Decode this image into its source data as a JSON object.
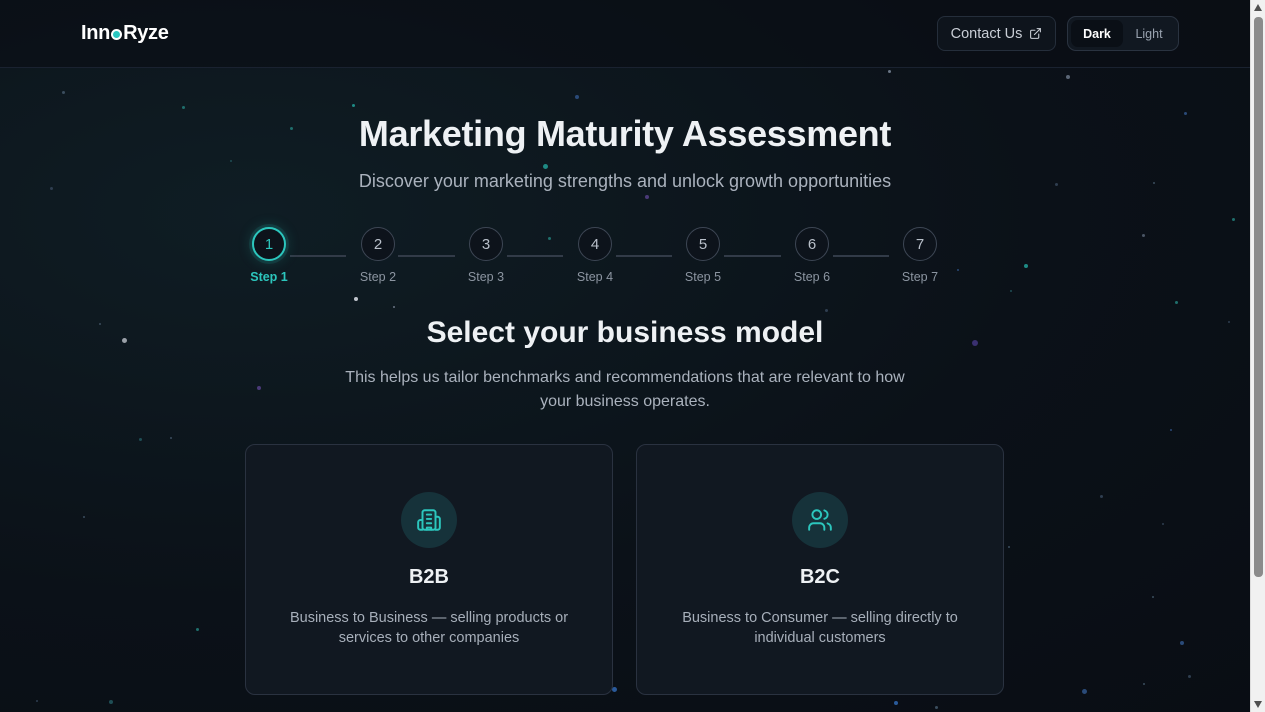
{
  "brand": {
    "name_part1": "Inn",
    "name_part2": "Ryze"
  },
  "header": {
    "contact_label": "Contact Us",
    "theme": {
      "options": [
        "Dark",
        "Light"
      ],
      "selected": "Dark"
    }
  },
  "hero": {
    "title": "Marketing Maturity Assessment",
    "subtitle": "Discover your marketing strengths and unlock growth opportunities"
  },
  "stepper": {
    "current_step": 1,
    "steps": [
      {
        "number": "1",
        "label": "Step 1"
      },
      {
        "number": "2",
        "label": "Step 2"
      },
      {
        "number": "3",
        "label": "Step 3"
      },
      {
        "number": "4",
        "label": "Step 4"
      },
      {
        "number": "5",
        "label": "Step 5"
      },
      {
        "number": "6",
        "label": "Step 6"
      },
      {
        "number": "7",
        "label": "Step 7"
      }
    ]
  },
  "section": {
    "title": "Select your business model",
    "description": "This helps us tailor benchmarks and recommendations that are relevant to how your business operates."
  },
  "options": [
    {
      "icon": "building-icon",
      "name": "B2B",
      "description": "Business to Business — selling products or services to other companies"
    },
    {
      "icon": "users-icon",
      "name": "B2C",
      "description": "Business to Consumer — selling directly to individual customers"
    }
  ],
  "colors": {
    "accent": "#2cc6bd",
    "background": "#0b1118",
    "card": "#111821"
  }
}
